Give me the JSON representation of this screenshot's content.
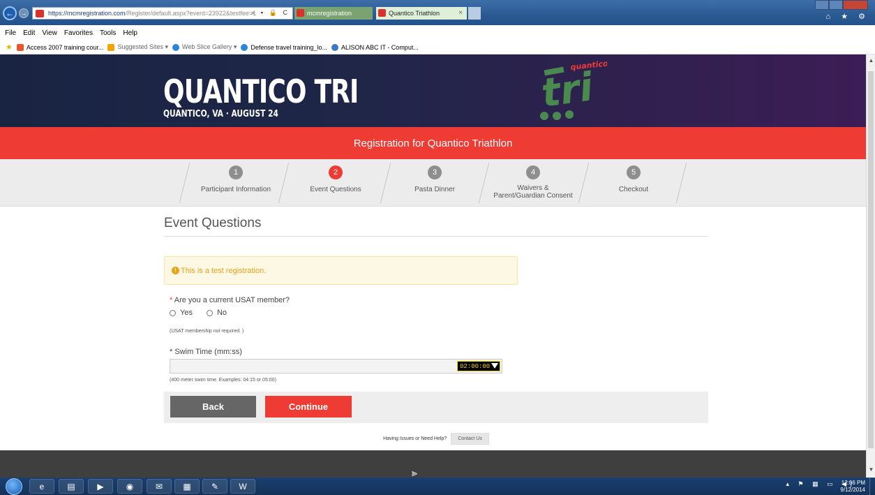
{
  "browser": {
    "url_host": "https://mcmregistration.com",
    "url_path": "/Register/default.aspx?event=23922&testfee=1",
    "addr_tools": "⌕ ▾ 🔒 C",
    "tabs": [
      {
        "label": "mcmregistration"
      },
      {
        "label": "Quantico Triathlon",
        "close": "×"
      }
    ],
    "right_icons": "⌂ ★ ⚙",
    "menu": [
      "File",
      "Edit",
      "View",
      "Favorites",
      "Tools",
      "Help"
    ],
    "favorites": [
      {
        "label": "Access 2007 training cour...",
        "color": "#e8572b"
      },
      {
        "label": "Suggested Sites ▾",
        "color": "#f0a500"
      },
      {
        "label": "Web Slice Gallery ▾",
        "color": "#2a86d9"
      },
      {
        "label": "Defense travel training_lo...",
        "color": "#2a86d9"
      },
      {
        "label": "ALISON ABC IT - Comput...",
        "color": "#3a7ac2"
      }
    ]
  },
  "hero": {
    "title": "QUANTICO TRI",
    "subtitle": "QUANTICO, VA · AUGUST 24",
    "logo_word": "quantico",
    "logo_letters": "tri"
  },
  "banner": "Registration for Quantico Triathlon",
  "steps": [
    {
      "num": "1",
      "label": "Participant Information",
      "active": false
    },
    {
      "num": "2",
      "label": "Event Questions",
      "active": true
    },
    {
      "num": "3",
      "label": "Pasta Dinner",
      "active": false
    },
    {
      "num": "4",
      "label": "Waivers &",
      "label2": "Parent/Guardian Consent",
      "active": false
    },
    {
      "num": "5",
      "label": "Checkout",
      "active": false
    }
  ],
  "form": {
    "title": "Event Questions",
    "alert_icon": "!",
    "alert": "This is a test registration.",
    "req_mark": "*",
    "q_usat": "Are you a current USAT member?",
    "opt_yes": "Yes",
    "opt_no": "No",
    "usat_hint": "(USAT membership not required. )",
    "q_swim": "Swim Time (mm:ss)",
    "swim_value": "",
    "swim_picker": "02:00:00",
    "swim_hint": "(400 meter swim time. Examples: 04:15 or 05:00)",
    "back": "Back",
    "continue": "Continue",
    "help_text": "Having Issues or Need Help?",
    "contact": "Contact Us"
  },
  "footer_mark": "⪢",
  "taskbar": {
    "apps": [
      "e",
      "▤",
      "▶",
      "◉",
      "✉",
      "▦",
      "✎",
      "W"
    ],
    "tray": "▴ ⚑ ▦ ▭ ◀)",
    "time": "12:06 PM",
    "date": "9/12/2014"
  },
  "colors": {
    "accent": "#ee3b33",
    "hero": "#1f2648",
    "alert": "#e8a317"
  }
}
